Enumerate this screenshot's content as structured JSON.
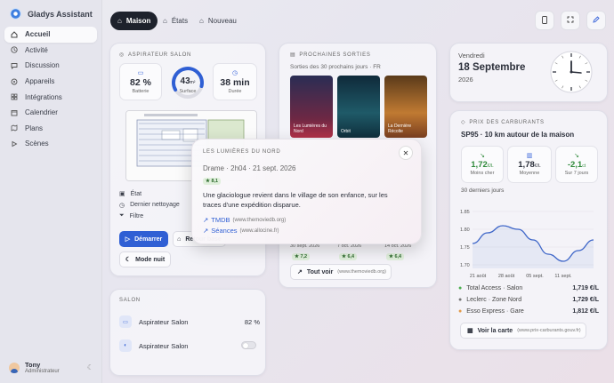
{
  "app": {
    "title": "Gladys Assistant"
  },
  "sidebar": {
    "items": [
      {
        "label": "Accueil",
        "icon": "home-icon",
        "active": true
      },
      {
        "label": "Activité",
        "icon": "clock-icon"
      },
      {
        "label": "Discussion",
        "icon": "chat-icon"
      },
      {
        "label": "Appareils",
        "icon": "devices-icon"
      },
      {
        "label": "Intégrations",
        "icon": "grid-icon"
      },
      {
        "label": "Calendrier",
        "icon": "calendar-icon"
      },
      {
        "label": "Plans",
        "icon": "map-icon"
      },
      {
        "label": "Scènes",
        "icon": "scene-icon"
      }
    ]
  },
  "user": {
    "name": "Tony",
    "role": "Administrateur"
  },
  "tabs": [
    {
      "label": "Maison",
      "active": true
    },
    {
      "label": "États"
    },
    {
      "label": "Nouveau"
    }
  ],
  "vacuum": {
    "title": "Aspirateur Salon",
    "battery": {
      "value": "82 %",
      "label": "Batterie"
    },
    "surface": {
      "value": "43",
      "unit": "m²",
      "label": "Surface"
    },
    "duration": {
      "value": "38 min",
      "label": "Durée"
    },
    "rows": [
      "État",
      "Dernier nettoyage",
      "Filtre"
    ],
    "start_label": "Démarrer",
    "return_label": "Retour base",
    "night_label": "Mode nuit"
  },
  "salon": {
    "title": "Salon",
    "rows": [
      {
        "label": "Aspirateur Salon",
        "value": "82 %"
      },
      {
        "label": "Aspirateur Salon"
      }
    ]
  },
  "movies": {
    "title": "Prochaines sorties",
    "subtitle": "Sorties des 30 prochains jours · FR",
    "posters": [
      {
        "title": "Les Lumières du Nord",
        "date": "30 sept. 2026",
        "rating": "★ 7,2"
      },
      {
        "title": "Orbit",
        "date": "7 oct. 2026",
        "rating": "★ 6,4"
      },
      {
        "title": "La Dernière Récolte",
        "date": "14 oct. 2026",
        "rating": "★ 6,4"
      }
    ],
    "see_all": "Tout voir",
    "see_all_src": "(www.themoviedb.org)"
  },
  "date_card": {
    "weekday": "Vendredi",
    "date": "18 Septembre",
    "year": "2026"
  },
  "fuel": {
    "title": "Prix des carburants",
    "subtitle": "SP95 · 10 km autour de la maison",
    "stats": [
      {
        "value": "1,72",
        "unit": "€/L",
        "label": "Moins cher",
        "color": "#2f8a3a"
      },
      {
        "value": "1,78",
        "unit": "€/L",
        "label": "Moyenne",
        "color": "#2b2f3a"
      },
      {
        "value": "-2,1",
        "unit": "ct",
        "label": "Sur 7 jours",
        "color": "#2f8a3a"
      }
    ],
    "period": "30 derniers jours",
    "stations": [
      {
        "name": "Total Access · Salon",
        "price": "1,719 €/L",
        "color": "#4caf50"
      },
      {
        "name": "Leclerc · Zone Nord",
        "price": "1,729 €/L",
        "color": "#777"
      },
      {
        "name": "Esso Express · Gare",
        "price": "1,812 €/L",
        "color": "#e39b4b"
      }
    ],
    "map_label": "Voir la carte",
    "map_src": "(www.prix-carburants.gouv.fr)"
  },
  "chart_data": {
    "type": "line",
    "x": [
      "21 août",
      "28 août",
      "05 sept.",
      "11 sept."
    ],
    "series": [
      {
        "values": [
          1.76,
          1.79,
          1.81,
          1.8,
          1.77,
          1.73,
          1.71,
          1.74,
          1.77
        ]
      }
    ],
    "yticks": [
      "1.85",
      "1.80",
      "1.75",
      "1.70"
    ],
    "ylim": [
      1.69,
      1.86
    ],
    "color": "#3e66c8"
  },
  "modal": {
    "heading": "Les Lumières du Nord",
    "meta": "Drame · 2h04 · 21 sept. 2026",
    "rating": "★ 8,1",
    "synopsis": "Une glaciologue revient dans le village de son enfance, sur les traces d'une expédition disparue.",
    "links": [
      {
        "label": "TMDB",
        "src": "(www.themoviedb.org)"
      },
      {
        "label": "Séances",
        "src": "(www.allocine.fr)"
      }
    ]
  }
}
